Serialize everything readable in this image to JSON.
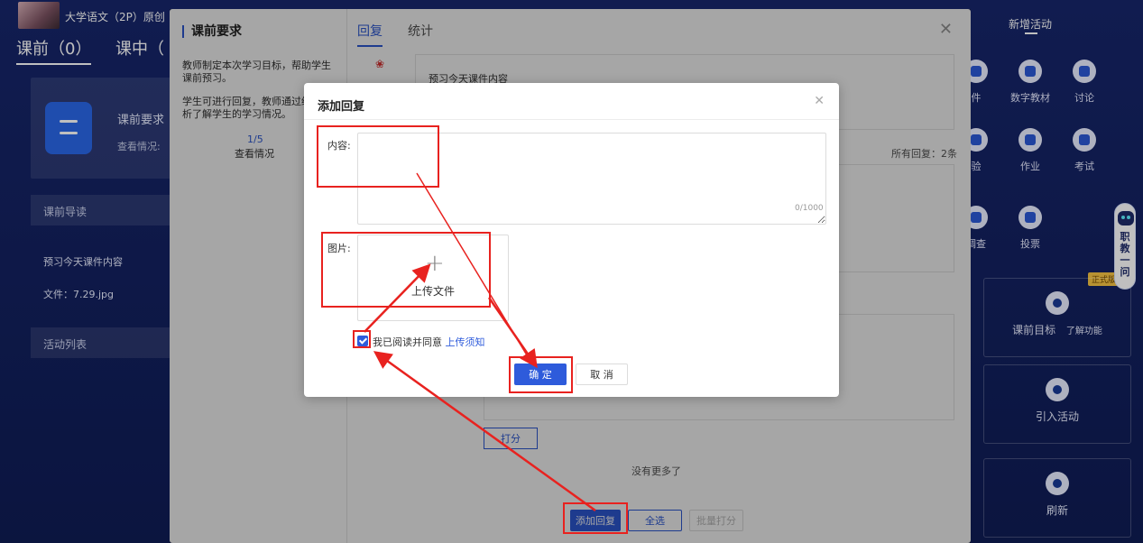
{
  "app": {
    "course_title": "大学语文（2P）原创",
    "tabs": [
      "课前（0）",
      "课中（"
    ],
    "left_card_title": "课前要求",
    "left_card_sub": "查看情况:",
    "section_guide": "课前导读",
    "guide_text": "预习今天课件内容",
    "guide_file": "文件：7.29.jpg",
    "section_activities": "活动列表"
  },
  "right": {
    "add_activity": "新增活动",
    "tools": [
      {
        "label": "件",
        "icon": "courseware-icon"
      },
      {
        "label": "数字教材",
        "icon": "digital-textbook-icon"
      },
      {
        "label": "讨论",
        "icon": "discussion-icon"
      },
      {
        "label": "验",
        "icon": "quiz-icon"
      },
      {
        "label": "作业",
        "icon": "homework-icon"
      },
      {
        "label": "考试",
        "icon": "exam-icon"
      },
      {
        "label": "调查",
        "icon": "survey-icon"
      },
      {
        "label": "投票",
        "icon": "vote-icon"
      }
    ],
    "official_badge": "正式版",
    "goal_label": "课前目标",
    "goal_link": "了解功能",
    "import_label": "引入活动",
    "refresh_label": "刷新",
    "assistant_text": "职教一问"
  },
  "panel": {
    "heading": "课前要求",
    "desc1": "教师制定本次学习目标，帮助学生课前预习。",
    "desc2": "学生可进行回复，教师通过统计分析了解学生的学习情况。",
    "stat_num": "1/5",
    "stat_label": "查看情况",
    "tab_reply": "回复",
    "tab_stats": "统计",
    "content_text": "预习今天课件内容",
    "all_replies": "所有回复：2条",
    "score_btn": "打分",
    "no_more": "没有更多了",
    "add_reply_btn": "添加回复",
    "select_all_btn": "全选",
    "batch_score_btn": "批量打分"
  },
  "modal": {
    "title": "添加回复",
    "content_label": "内容:",
    "content_value": "",
    "char_count": "0/1000",
    "image_label": "图片:",
    "upload_text": "上传文件",
    "agree_text": "我已阅读并同意",
    "agree_link": "上传须知",
    "ok_btn": "确 定",
    "cancel_btn": "取 消"
  },
  "colors": {
    "accent": "#2e5bdb",
    "annotation": "#e8221f"
  }
}
